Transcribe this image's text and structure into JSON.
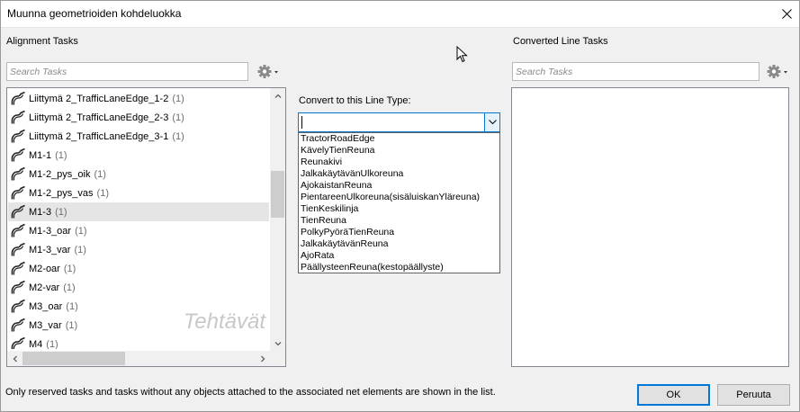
{
  "window": {
    "title": "Muunna geometrioiden kohdeluokka"
  },
  "left_panel": {
    "label": "Alignment Tasks",
    "search_placeholder": "Search Tasks",
    "watermark": "Tehtävät",
    "tasks": [
      {
        "name": "Liittymä 2_TrafficLaneEdge_1-2",
        "count": "(1)"
      },
      {
        "name": "Liittymä 2_TrafficLaneEdge_2-3",
        "count": "(1)"
      },
      {
        "name": "Liittymä 2_TrafficLaneEdge_3-1",
        "count": "(1)"
      },
      {
        "name": "M1-1",
        "count": "(1)"
      },
      {
        "name": "M1-2_pys_oik",
        "count": "(1)"
      },
      {
        "name": "M1-2_pys_vas",
        "count": "(1)"
      },
      {
        "name": "M1-3",
        "count": "(1)"
      },
      {
        "name": "M1-3_oar",
        "count": "(1)"
      },
      {
        "name": "M1-3_var",
        "count": "(1)"
      },
      {
        "name": "M2-oar",
        "count": "(1)"
      },
      {
        "name": "M2-var",
        "count": "(1)"
      },
      {
        "name": "M3_oar",
        "count": "(1)"
      },
      {
        "name": "M3_var",
        "count": "(1)"
      },
      {
        "name": "M4",
        "count": "(1)"
      }
    ],
    "selected_index": 6
  },
  "center": {
    "label": "Convert to this Line Type:",
    "current_value": "",
    "options": [
      "TractorRoadEdge",
      "KävelyTienReuna",
      "Reunakivi",
      "JalkakäytävänUlkoreuna",
      "AjokaistanReuna",
      "PientareenUlkoreuna(sisäluiskanYläreuna)",
      "TienKeskilinja",
      "TienReuna",
      "PolkyPyöräTienReuna",
      "JalkakäytävänReuna",
      "AjoRata",
      "PäällysteenReuna(kestopäällyste)"
    ]
  },
  "right_panel": {
    "label": "Converted Line Tasks",
    "search_placeholder": "Search Tasks"
  },
  "footer": {
    "info": "Only reserved tasks and tasks without any objects attached to the associated net elements are shown in the list.",
    "ok_label": "OK",
    "cancel_label": "Peruuta"
  },
  "icons": {
    "task_icon": "line-string-icon",
    "gear": "gear-icon",
    "close": "close-icon"
  }
}
